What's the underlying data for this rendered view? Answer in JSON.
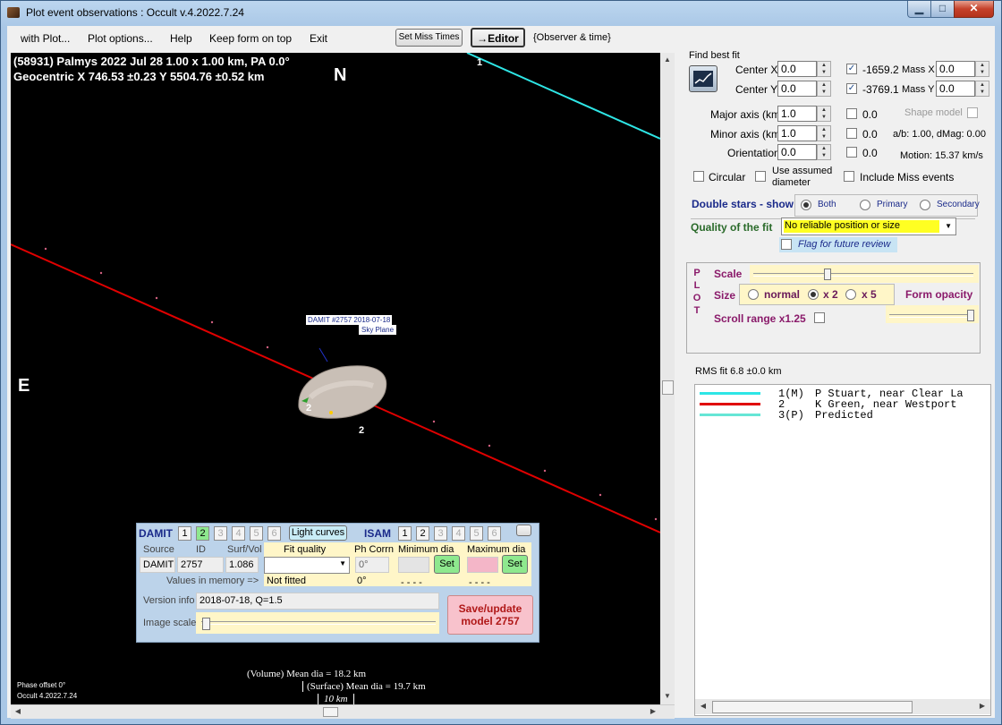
{
  "window": {
    "title": "Plot event observations : Occult v.4.2022.7.24"
  },
  "menu": {
    "items": [
      "with Plot...",
      "Plot options...",
      "Help",
      "Keep form on top",
      "Exit"
    ],
    "set_miss_times": "Set Miss Times",
    "editor": "→Editor",
    "observer_time": "{Observer & time}"
  },
  "plot": {
    "header_line1": "(58931) Palmys  2022 Jul 28   1.00 x 1.00 km, PA 0.0°",
    "header_line2": "Geocentric  X  746.53 ±0.23  Y 5504.76 ±0.52 km",
    "north": "N",
    "east": "E",
    "chord_label_1": "1",
    "chord_label_2a": "2",
    "chord_label_2b": "2",
    "shape_label": "DAMIT #2757 2018-07-18",
    "sky_plane": "Sky Plane",
    "volume_dia": "(Volume) Mean dia = 18.2 km",
    "surface_dia": "(Surface) Mean dia = 19.7 km",
    "scale_bar": "10 km",
    "phase_offset": "Phase offset 0°",
    "version": "Occult 4.2022.7.24"
  },
  "fit": {
    "find_best_fit": "Find best fit",
    "center_x_label": "Center X",
    "center_x": "0.0",
    "center_y_label": "Center Y",
    "center_y": "0.0",
    "x_value": "-1659.2",
    "y_value": "-3769.1",
    "mass_x_label": "Mass X",
    "mass_x": "0.0",
    "mass_y_label": "Mass Y",
    "mass_y": "0.0",
    "major_label": "Major axis (km)",
    "major": "1.0",
    "major_fit": "0.0",
    "minor_label": "Minor axis (km)",
    "minor": "1.0",
    "minor_fit": "0.0",
    "orient_label": "Orientation",
    "orient": "0.0",
    "orient_fit": "0.0",
    "shape_model": "Shape model",
    "ab_dmag": "a/b: 1.00, dMag: 0.00",
    "motion": "Motion: 15.37 km/s",
    "circular": "Circular",
    "use_assumed_1": "Use assumed",
    "use_assumed_2": "diameter",
    "include_miss": "Include Miss events",
    "double_stars": "Double stars - show",
    "both": "Both",
    "primary": "Primary",
    "secondary": "Secondary",
    "quality_label": "Quality of the fit",
    "quality_value": "No reliable position or size",
    "flag_review": "Flag for future review"
  },
  "plot_panel": {
    "plot_letters": [
      "P",
      "L",
      "O",
      "T"
    ],
    "scale": "Scale",
    "size": "Size",
    "normal": "normal",
    "x2": "x 2",
    "x5": "x 5",
    "form_opacity": "Form opacity",
    "scroll_range": "Scroll range x1.25",
    "scale_level": 0.33,
    "opacity_level": 0.97
  },
  "rms": "RMS fit 6.8 ±0.0 km",
  "legend": [
    {
      "id": "1(M)",
      "observer": "P Stuart, near Clear La",
      "color": "#2ee6e6"
    },
    {
      "id": "2",
      "observer": "K Green, near Westport",
      "color": "#e00000"
    },
    {
      "id": "3(P)",
      "observer": "Predicted",
      "color": "#66e6d6"
    }
  ],
  "damit": {
    "title": "DAMIT",
    "numbers": [
      "1",
      "2",
      "3",
      "4",
      "5",
      "6"
    ],
    "light_curves": "Light curves",
    "isam": "ISAM",
    "isam_numbers": [
      "1",
      "2",
      "3",
      "4",
      "5",
      "6"
    ],
    "source_h": "Source",
    "id_h": "ID",
    "surf_h": "Surf/Vol",
    "fit_quality_h": "Fit quality",
    "ph_corrn_h": "Ph Corrn",
    "min_dia_h": "Minimum dia",
    "max_dia_h": "Maximum dia",
    "source": "DAMIT",
    "id": "2757",
    "surf": "1.086",
    "ph_corrn": "0°",
    "set": "Set",
    "values_mem": "Values in memory =>",
    "not_fitted": "Not fitted",
    "ph_mem": "0°",
    "min_mem": "- - - -",
    "max_mem": "- - - -",
    "version_info_label": "Version info",
    "version_info": "2018-07-18, Q=1.5",
    "image_scale": "Image scale",
    "save_line1": "Save/update",
    "save_line2": "model 2757"
  }
}
